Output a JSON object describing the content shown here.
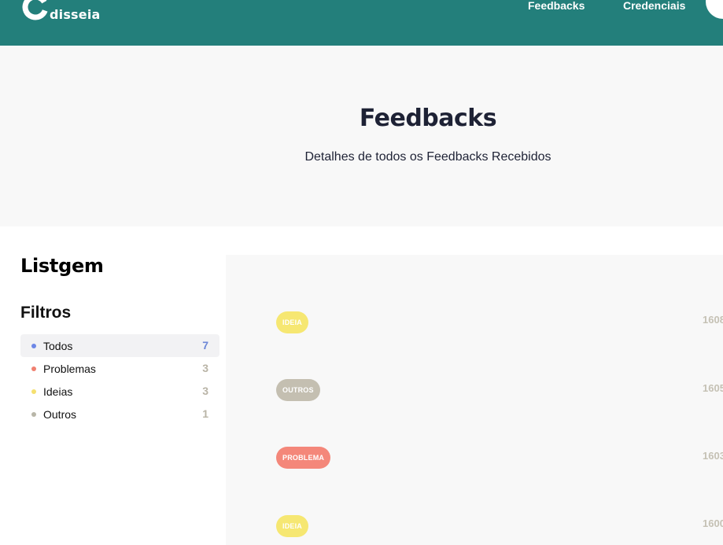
{
  "brand": {
    "name": "disseia"
  },
  "nav": {
    "feedbacks": "Feedbacks",
    "credenciais": "Credenciais"
  },
  "hero": {
    "title": "Feedbacks",
    "subtitle": "Detalhes de todos os Feedbacks Recebidos"
  },
  "sidebar": {
    "title": "Listgem",
    "filters_title": "Filtros",
    "filters": [
      {
        "label": "Todos",
        "count": "7",
        "color": "#6d87e6",
        "active": true
      },
      {
        "label": "Problemas",
        "count": "3",
        "color": "#f08070",
        "active": false
      },
      {
        "label": "Ideias",
        "count": "3",
        "color": "#f5e070",
        "active": false
      },
      {
        "label": "Outros",
        "count": "1",
        "color": "#b8b6a8",
        "active": false
      }
    ]
  },
  "feedbacks": [
    {
      "type": "IDEIA",
      "color": "#f6e772",
      "id": "1608"
    },
    {
      "type": "OUTROS",
      "color": "#c4bfb1",
      "id": "1605"
    },
    {
      "type": "PROBLEMA",
      "color": "#f4877a",
      "id": "1603"
    },
    {
      "type": "IDEIA",
      "color": "#f6e772",
      "id": "1600"
    }
  ]
}
